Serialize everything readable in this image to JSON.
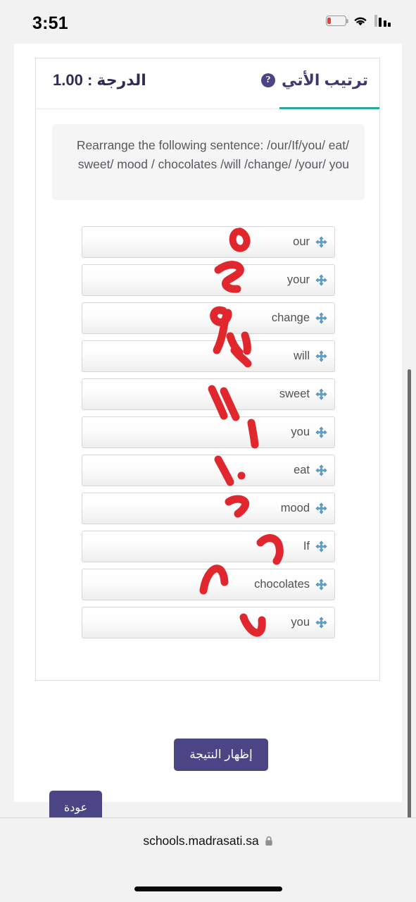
{
  "status_bar": {
    "time": "3:51",
    "signal_icon": "cellular-signal-icon",
    "wifi_icon": "wifi-icon",
    "battery_icon": "battery-low-icon"
  },
  "card": {
    "grade_label": "الدرجة : 1.00",
    "question_type_label": "ترتيب الأتي",
    "help_icon": "question-mark-icon",
    "help_glyph": "?",
    "tab_underline_color": "#29a99b"
  },
  "instruction": {
    "text": "Rearrange the following sentence:  /our/If/you/ eat/ sweet/ mood / chocolates /will /change/ /your/ you"
  },
  "sortable": {
    "move_icon": "move-arrows-icon",
    "items": [
      {
        "label": "our",
        "annotation": "٥"
      },
      {
        "label": "your",
        "annotation": "٤"
      },
      {
        "label": "change",
        "annotation": "٩"
      },
      {
        "label": "will",
        "annotation": "٣"
      },
      {
        "label": "sweet",
        "annotation": "١١"
      },
      {
        "label": "you",
        "annotation": "١"
      },
      {
        "label": "eat",
        "annotation": "١٠"
      },
      {
        "label": "mood",
        "annotation": "٧"
      },
      {
        "label": "If",
        "annotation": "٦"
      },
      {
        "label": "chocolates",
        "annotation": "٨"
      },
      {
        "label": "you",
        "annotation": "٢"
      }
    ]
  },
  "buttons": {
    "show_result": "إظهار النتيجة",
    "back": "عودة",
    "color": "#4b4585"
  },
  "browser_bar": {
    "url": "schools.madrasati.sa",
    "lock_icon": "lock-icon"
  },
  "colors": {
    "accent_purple": "#4b4585",
    "teal_underline": "#29a99b",
    "annotation_red": "#e0272e",
    "move_icon_blue": "#4a90c4",
    "page_background": "#f2f2f2"
  }
}
